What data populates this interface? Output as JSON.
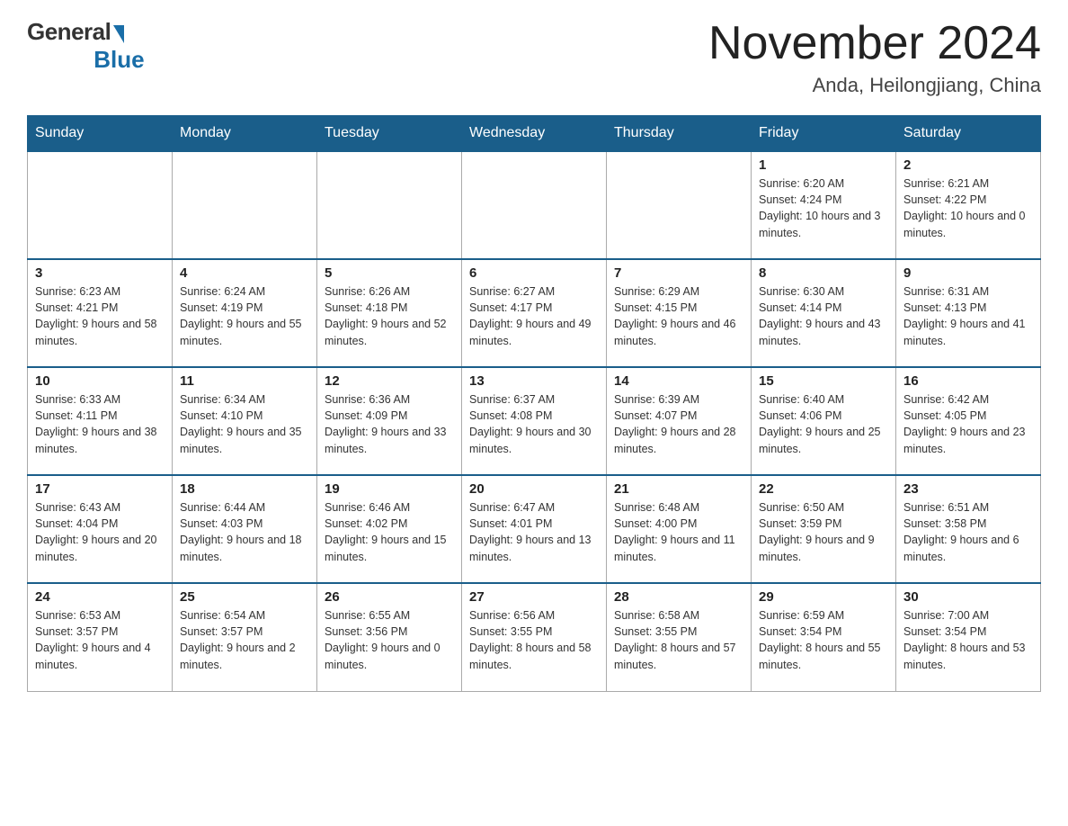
{
  "header": {
    "logo_general": "General",
    "logo_blue": "Blue",
    "month_title": "November 2024",
    "location": "Anda, Heilongjiang, China"
  },
  "weekdays": [
    "Sunday",
    "Monday",
    "Tuesday",
    "Wednesday",
    "Thursday",
    "Friday",
    "Saturday"
  ],
  "weeks": [
    [
      {
        "day": "",
        "empty": true
      },
      {
        "day": "",
        "empty": true
      },
      {
        "day": "",
        "empty": true
      },
      {
        "day": "",
        "empty": true
      },
      {
        "day": "",
        "empty": true
      },
      {
        "day": "1",
        "sunrise": "6:20 AM",
        "sunset": "4:24 PM",
        "daylight": "10 hours and 3 minutes."
      },
      {
        "day": "2",
        "sunrise": "6:21 AM",
        "sunset": "4:22 PM",
        "daylight": "10 hours and 0 minutes."
      }
    ],
    [
      {
        "day": "3",
        "sunrise": "6:23 AM",
        "sunset": "4:21 PM",
        "daylight": "9 hours and 58 minutes."
      },
      {
        "day": "4",
        "sunrise": "6:24 AM",
        "sunset": "4:19 PM",
        "daylight": "9 hours and 55 minutes."
      },
      {
        "day": "5",
        "sunrise": "6:26 AM",
        "sunset": "4:18 PM",
        "daylight": "9 hours and 52 minutes."
      },
      {
        "day": "6",
        "sunrise": "6:27 AM",
        "sunset": "4:17 PM",
        "daylight": "9 hours and 49 minutes."
      },
      {
        "day": "7",
        "sunrise": "6:29 AM",
        "sunset": "4:15 PM",
        "daylight": "9 hours and 46 minutes."
      },
      {
        "day": "8",
        "sunrise": "6:30 AM",
        "sunset": "4:14 PM",
        "daylight": "9 hours and 43 minutes."
      },
      {
        "day": "9",
        "sunrise": "6:31 AM",
        "sunset": "4:13 PM",
        "daylight": "9 hours and 41 minutes."
      }
    ],
    [
      {
        "day": "10",
        "sunrise": "6:33 AM",
        "sunset": "4:11 PM",
        "daylight": "9 hours and 38 minutes."
      },
      {
        "day": "11",
        "sunrise": "6:34 AM",
        "sunset": "4:10 PM",
        "daylight": "9 hours and 35 minutes."
      },
      {
        "day": "12",
        "sunrise": "6:36 AM",
        "sunset": "4:09 PM",
        "daylight": "9 hours and 33 minutes."
      },
      {
        "day": "13",
        "sunrise": "6:37 AM",
        "sunset": "4:08 PM",
        "daylight": "9 hours and 30 minutes."
      },
      {
        "day": "14",
        "sunrise": "6:39 AM",
        "sunset": "4:07 PM",
        "daylight": "9 hours and 28 minutes."
      },
      {
        "day": "15",
        "sunrise": "6:40 AM",
        "sunset": "4:06 PM",
        "daylight": "9 hours and 25 minutes."
      },
      {
        "day": "16",
        "sunrise": "6:42 AM",
        "sunset": "4:05 PM",
        "daylight": "9 hours and 23 minutes."
      }
    ],
    [
      {
        "day": "17",
        "sunrise": "6:43 AM",
        "sunset": "4:04 PM",
        "daylight": "9 hours and 20 minutes."
      },
      {
        "day": "18",
        "sunrise": "6:44 AM",
        "sunset": "4:03 PM",
        "daylight": "9 hours and 18 minutes."
      },
      {
        "day": "19",
        "sunrise": "6:46 AM",
        "sunset": "4:02 PM",
        "daylight": "9 hours and 15 minutes."
      },
      {
        "day": "20",
        "sunrise": "6:47 AM",
        "sunset": "4:01 PM",
        "daylight": "9 hours and 13 minutes."
      },
      {
        "day": "21",
        "sunrise": "6:48 AM",
        "sunset": "4:00 PM",
        "daylight": "9 hours and 11 minutes."
      },
      {
        "day": "22",
        "sunrise": "6:50 AM",
        "sunset": "3:59 PM",
        "daylight": "9 hours and 9 minutes."
      },
      {
        "day": "23",
        "sunrise": "6:51 AM",
        "sunset": "3:58 PM",
        "daylight": "9 hours and 6 minutes."
      }
    ],
    [
      {
        "day": "24",
        "sunrise": "6:53 AM",
        "sunset": "3:57 PM",
        "daylight": "9 hours and 4 minutes."
      },
      {
        "day": "25",
        "sunrise": "6:54 AM",
        "sunset": "3:57 PM",
        "daylight": "9 hours and 2 minutes."
      },
      {
        "day": "26",
        "sunrise": "6:55 AM",
        "sunset": "3:56 PM",
        "daylight": "9 hours and 0 minutes."
      },
      {
        "day": "27",
        "sunrise": "6:56 AM",
        "sunset": "3:55 PM",
        "daylight": "8 hours and 58 minutes."
      },
      {
        "day": "28",
        "sunrise": "6:58 AM",
        "sunset": "3:55 PM",
        "daylight": "8 hours and 57 minutes."
      },
      {
        "day": "29",
        "sunrise": "6:59 AM",
        "sunset": "3:54 PM",
        "daylight": "8 hours and 55 minutes."
      },
      {
        "day": "30",
        "sunrise": "7:00 AM",
        "sunset": "3:54 PM",
        "daylight": "8 hours and 53 minutes."
      }
    ]
  ]
}
